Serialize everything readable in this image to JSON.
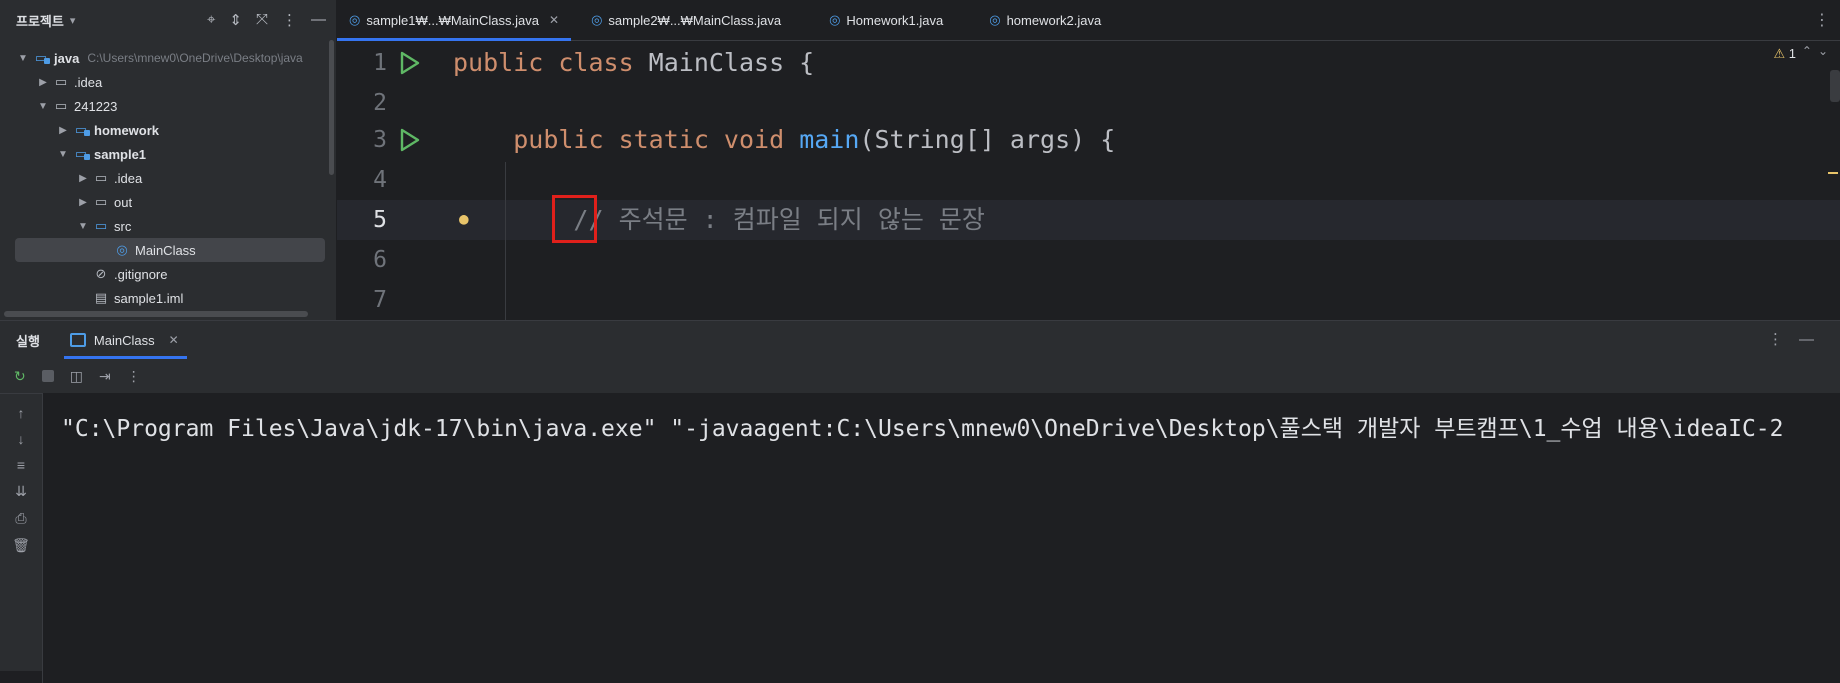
{
  "project_panel": {
    "title": "프로젝트",
    "tree": [
      {
        "label": "java",
        "path": "C:\\Users\\mnew0\\OneDrive\\Desktop\\java",
        "bold": true
      },
      {
        "label": ".idea"
      },
      {
        "label": "241223"
      },
      {
        "label": "homework",
        "bold": true
      },
      {
        "label": "sample1",
        "bold": true
      },
      {
        "label": ".idea"
      },
      {
        "label": "out"
      },
      {
        "label": "src"
      },
      {
        "label": "MainClass"
      },
      {
        "label": ".gitignore"
      },
      {
        "label": "sample1.iml"
      }
    ]
  },
  "editor": {
    "tabs": [
      {
        "label": "sample1₩...₩MainClass.java",
        "active": true
      },
      {
        "label": "sample2₩...₩MainClass.java"
      },
      {
        "label": "Homework1.java"
      },
      {
        "label": "homework2.java"
      }
    ],
    "warning_count": "1",
    "lines": [
      {
        "num": "1",
        "parts": [
          [
            "kw",
            "public class "
          ],
          [
            "plain",
            "MainClass {"
          ]
        ]
      },
      {
        "num": "2",
        "parts": []
      },
      {
        "num": "3",
        "parts": [
          [
            "plain",
            "    "
          ],
          [
            "kw",
            "public static void "
          ],
          [
            "fn",
            "main"
          ],
          [
            "plain",
            "(String[] args) {"
          ]
        ]
      },
      {
        "num": "4",
        "parts": []
      },
      {
        "num": "5",
        "parts": [
          [
            "plain",
            "        "
          ],
          [
            "cmt",
            "// 주석문 : 컴파일 되지 않는 문장"
          ]
        ]
      },
      {
        "num": "6",
        "parts": []
      },
      {
        "num": "7",
        "parts": []
      }
    ]
  },
  "run_panel": {
    "title": "실행",
    "tab_label": "MainClass",
    "console_output": "\"C:\\Program Files\\Java\\jdk-17\\bin\\java.exe\" \"-javaagent:C:\\Users\\mnew0\\OneDrive\\Desktop\\풀스택 개발자 부트캠프\\1_수업 내용\\ideaIC-2"
  },
  "colors": {
    "background": "#1e1f22",
    "panel": "#2b2d30",
    "keyword": "#cf8e6d",
    "function": "#56a8f5",
    "comment": "#7a7e85",
    "accent": "#3574f0",
    "highlight_box": "#e0201b"
  }
}
